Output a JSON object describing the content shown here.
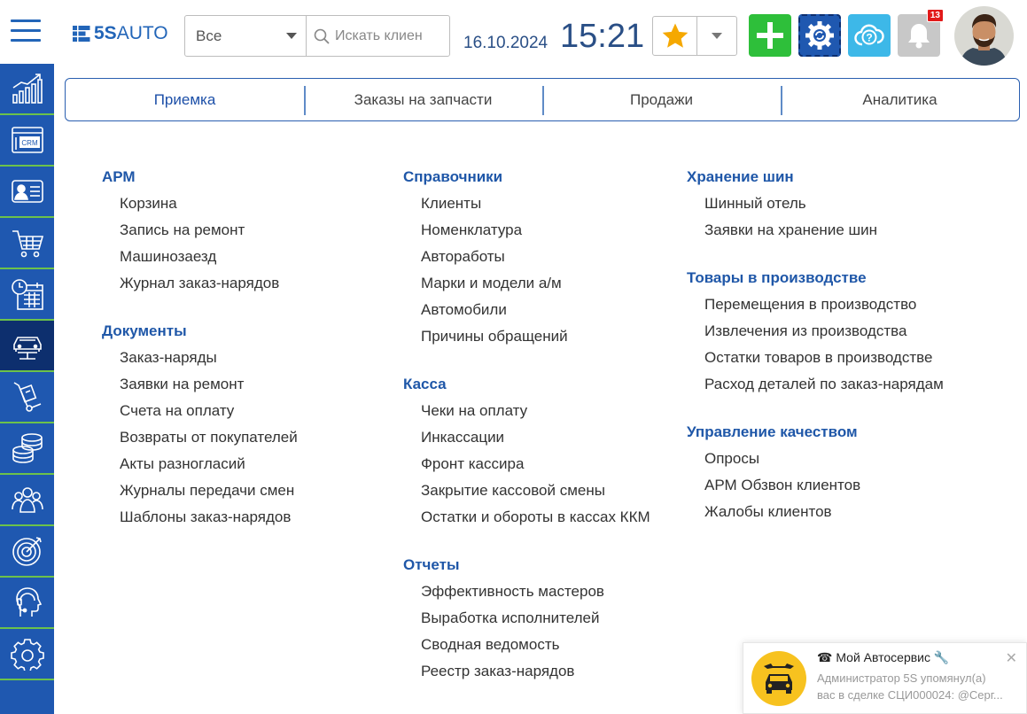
{
  "header": {
    "logo": {
      "prefix": "5S",
      "suffix": "AUTO"
    },
    "search": {
      "scope_value": "Все",
      "placeholder": "Искать клиен"
    },
    "date": "16.10.2024",
    "time": "15:21",
    "notifications_count": "13"
  },
  "tabs": [
    {
      "label": "Приемка"
    },
    {
      "label": "Заказы на запчасти"
    },
    {
      "label": "Продажи"
    },
    {
      "label": "Аналитика"
    }
  ],
  "columns": {
    "col1": [
      {
        "title": "АРМ",
        "items": [
          "Корзина",
          "Запись на ремонт",
          "Машинозаезд",
          "Журнал заказ-нарядов"
        ]
      },
      {
        "title": "Документы",
        "items": [
          "Заказ-наряды",
          "Заявки на ремонт",
          "Счета на оплату",
          "Возвраты от покупателей",
          "Акты разногласий",
          "Журналы передачи смен",
          "Шаблоны заказ-нарядов"
        ]
      }
    ],
    "col2": [
      {
        "title": "Справочники",
        "items": [
          "Клиенты",
          "Номенклатура",
          "Автоработы",
          "Марки и модели а/м",
          "Автомобили",
          "Причины обращений"
        ]
      },
      {
        "title": "Касса",
        "items": [
          "Чеки на оплату",
          "Инкассации",
          "Фронт кассира",
          "Закрытие кассовой смены",
          "Остатки и обороты в кассах ККМ"
        ]
      },
      {
        "title": "Отчеты",
        "items": [
          "Эффективность мастеров",
          "Выработка исполнителей",
          "Сводная ведомость",
          "Реестр заказ-нарядов"
        ]
      }
    ],
    "col3": [
      {
        "title": "Хранение шин",
        "items": [
          "Шинный отель",
          "Заявки на хранение шин"
        ]
      },
      {
        "title": "Товары в производстве",
        "items": [
          "Перемещения в производство",
          "Извлечения из производства",
          "Остатки товаров в производстве",
          "Расход деталей по заказ-нарядам"
        ]
      },
      {
        "title": "Управление качеством",
        "items": [
          "Опросы",
          "АРМ Обзвон клиентов",
          "Жалобы клиентов"
        ]
      }
    ]
  },
  "sidebar": {
    "items": [
      {
        "icon": "analytics-chart-icon"
      },
      {
        "icon": "crm-icon"
      },
      {
        "icon": "contact-card-icon"
      },
      {
        "icon": "shopping-cart-icon"
      },
      {
        "icon": "calendar-clock-icon"
      },
      {
        "icon": "car-lift-icon",
        "active": true
      },
      {
        "icon": "hand-truck-icon"
      },
      {
        "icon": "coins-stack-icon"
      },
      {
        "icon": "people-group-icon"
      },
      {
        "icon": "target-icon"
      },
      {
        "icon": "head-support-icon"
      },
      {
        "icon": "gear-icon"
      }
    ],
    "crm_label": "CRM"
  },
  "notification": {
    "title": "Мой Автосервис",
    "body_line1": "Администратор 5S упомянул(а)",
    "body_line2": "вас в сделке СЦИ000024: @Серг...",
    "close": "✕"
  },
  "colors": {
    "brand_blue": "#1f58b0",
    "sidebar_divider": "#6cc24a",
    "add_green": "#2ebf3a",
    "help_cyan": "#3db8e8",
    "star": "#f5a800",
    "badge_red": "#e21a1a"
  }
}
